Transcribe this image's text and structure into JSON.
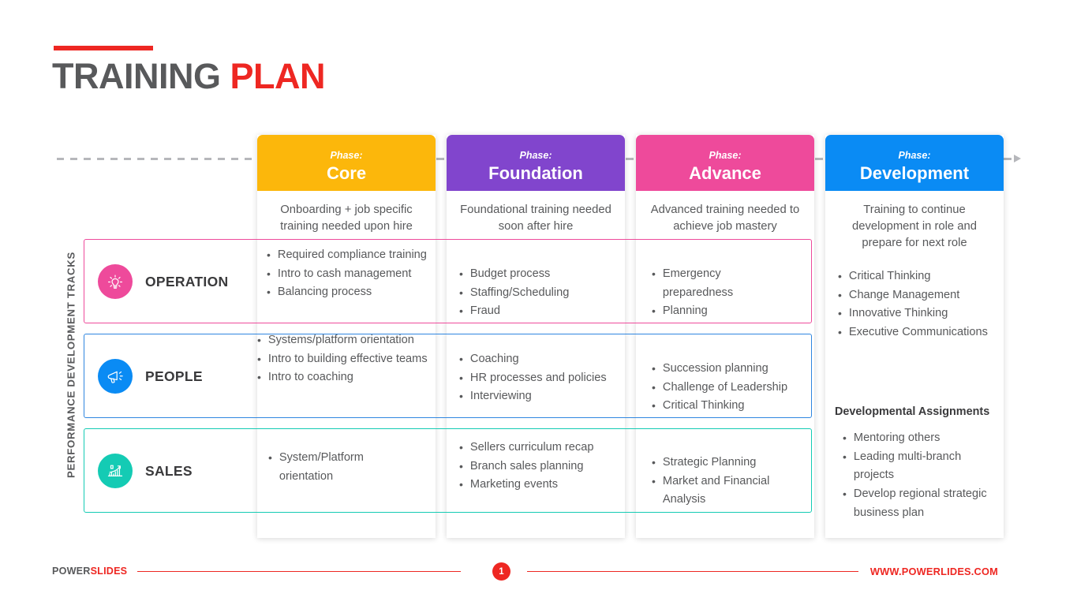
{
  "title": {
    "part1": "TRAINING ",
    "part2": "PLAN"
  },
  "vertical_axis_label": "PERFORMANCE DEVELOPMENT TRACKS",
  "colors": {
    "core": "#fcb70b",
    "foundation": "#8145cd",
    "advance": "#ee4a9b",
    "development": "#0a8bf4",
    "operation": "#ee4a9b",
    "people": "#0a8bf4",
    "sales": "#14cbb4",
    "accent_red": "#ee2722",
    "text_gray": "#58595b",
    "timeline_gray": "#b6b7bb"
  },
  "phase_label": "Phase:",
  "columns": [
    {
      "id": "core",
      "name": "Core",
      "description": "Onboarding + job specific training needed upon hire"
    },
    {
      "id": "foundation",
      "name": "Foundation",
      "description": "Foundational training needed soon after hire"
    },
    {
      "id": "advance",
      "name": "Advance",
      "description": "Advanced training needed to achieve job mastery"
    },
    {
      "id": "development",
      "name": "Development",
      "description": "Training to continue development in role and prepare for next role"
    }
  ],
  "tracks": [
    {
      "id": "operation",
      "label": "OPERATION",
      "icon": "lightbulb-icon"
    },
    {
      "id": "people",
      "label": "PEOPLE",
      "icon": "megaphone-icon"
    },
    {
      "id": "sales",
      "label": "SALES",
      "icon": "growth-chart-icon"
    }
  ],
  "cells": {
    "operation_core": [
      "Required compliance training",
      "Intro to cash management",
      "Balancing process"
    ],
    "operation_foundation": [
      "Budget process",
      "Staffing/Scheduling",
      "Fraud"
    ],
    "operation_advance": [
      "Emergency preparedness",
      "Planning"
    ],
    "people_core": [
      "Systems/platform orientation",
      "Intro to building effective teams",
      "Intro to coaching"
    ],
    "people_foundation": [
      "Coaching",
      "HR processes and policies",
      "Interviewing"
    ],
    "people_advance": [
      "Succession planning",
      "Challenge of Leadership",
      "Critical Thinking"
    ],
    "sales_core": [
      "System/Platform orientation"
    ],
    "sales_foundation": [
      "Sellers curriculum recap",
      "Branch sales planning",
      "Marketing events"
    ],
    "sales_advance": [
      "Strategic Planning",
      "Market and Financial Analysis"
    ]
  },
  "development_column": {
    "bullets": [
      "Critical Thinking",
      "Change Management",
      "Innovative Thinking",
      "Executive Communications"
    ],
    "subheading": "Developmental Assignments",
    "assignments": [
      "Mentoring others",
      "Leading multi-branch projects",
      "Develop regional strategic business plan"
    ]
  },
  "footer": {
    "logo_part1": "POWER",
    "logo_part2": "SLIDES",
    "page_number": "1",
    "url": "WWW.POWERLIDES.COM"
  }
}
